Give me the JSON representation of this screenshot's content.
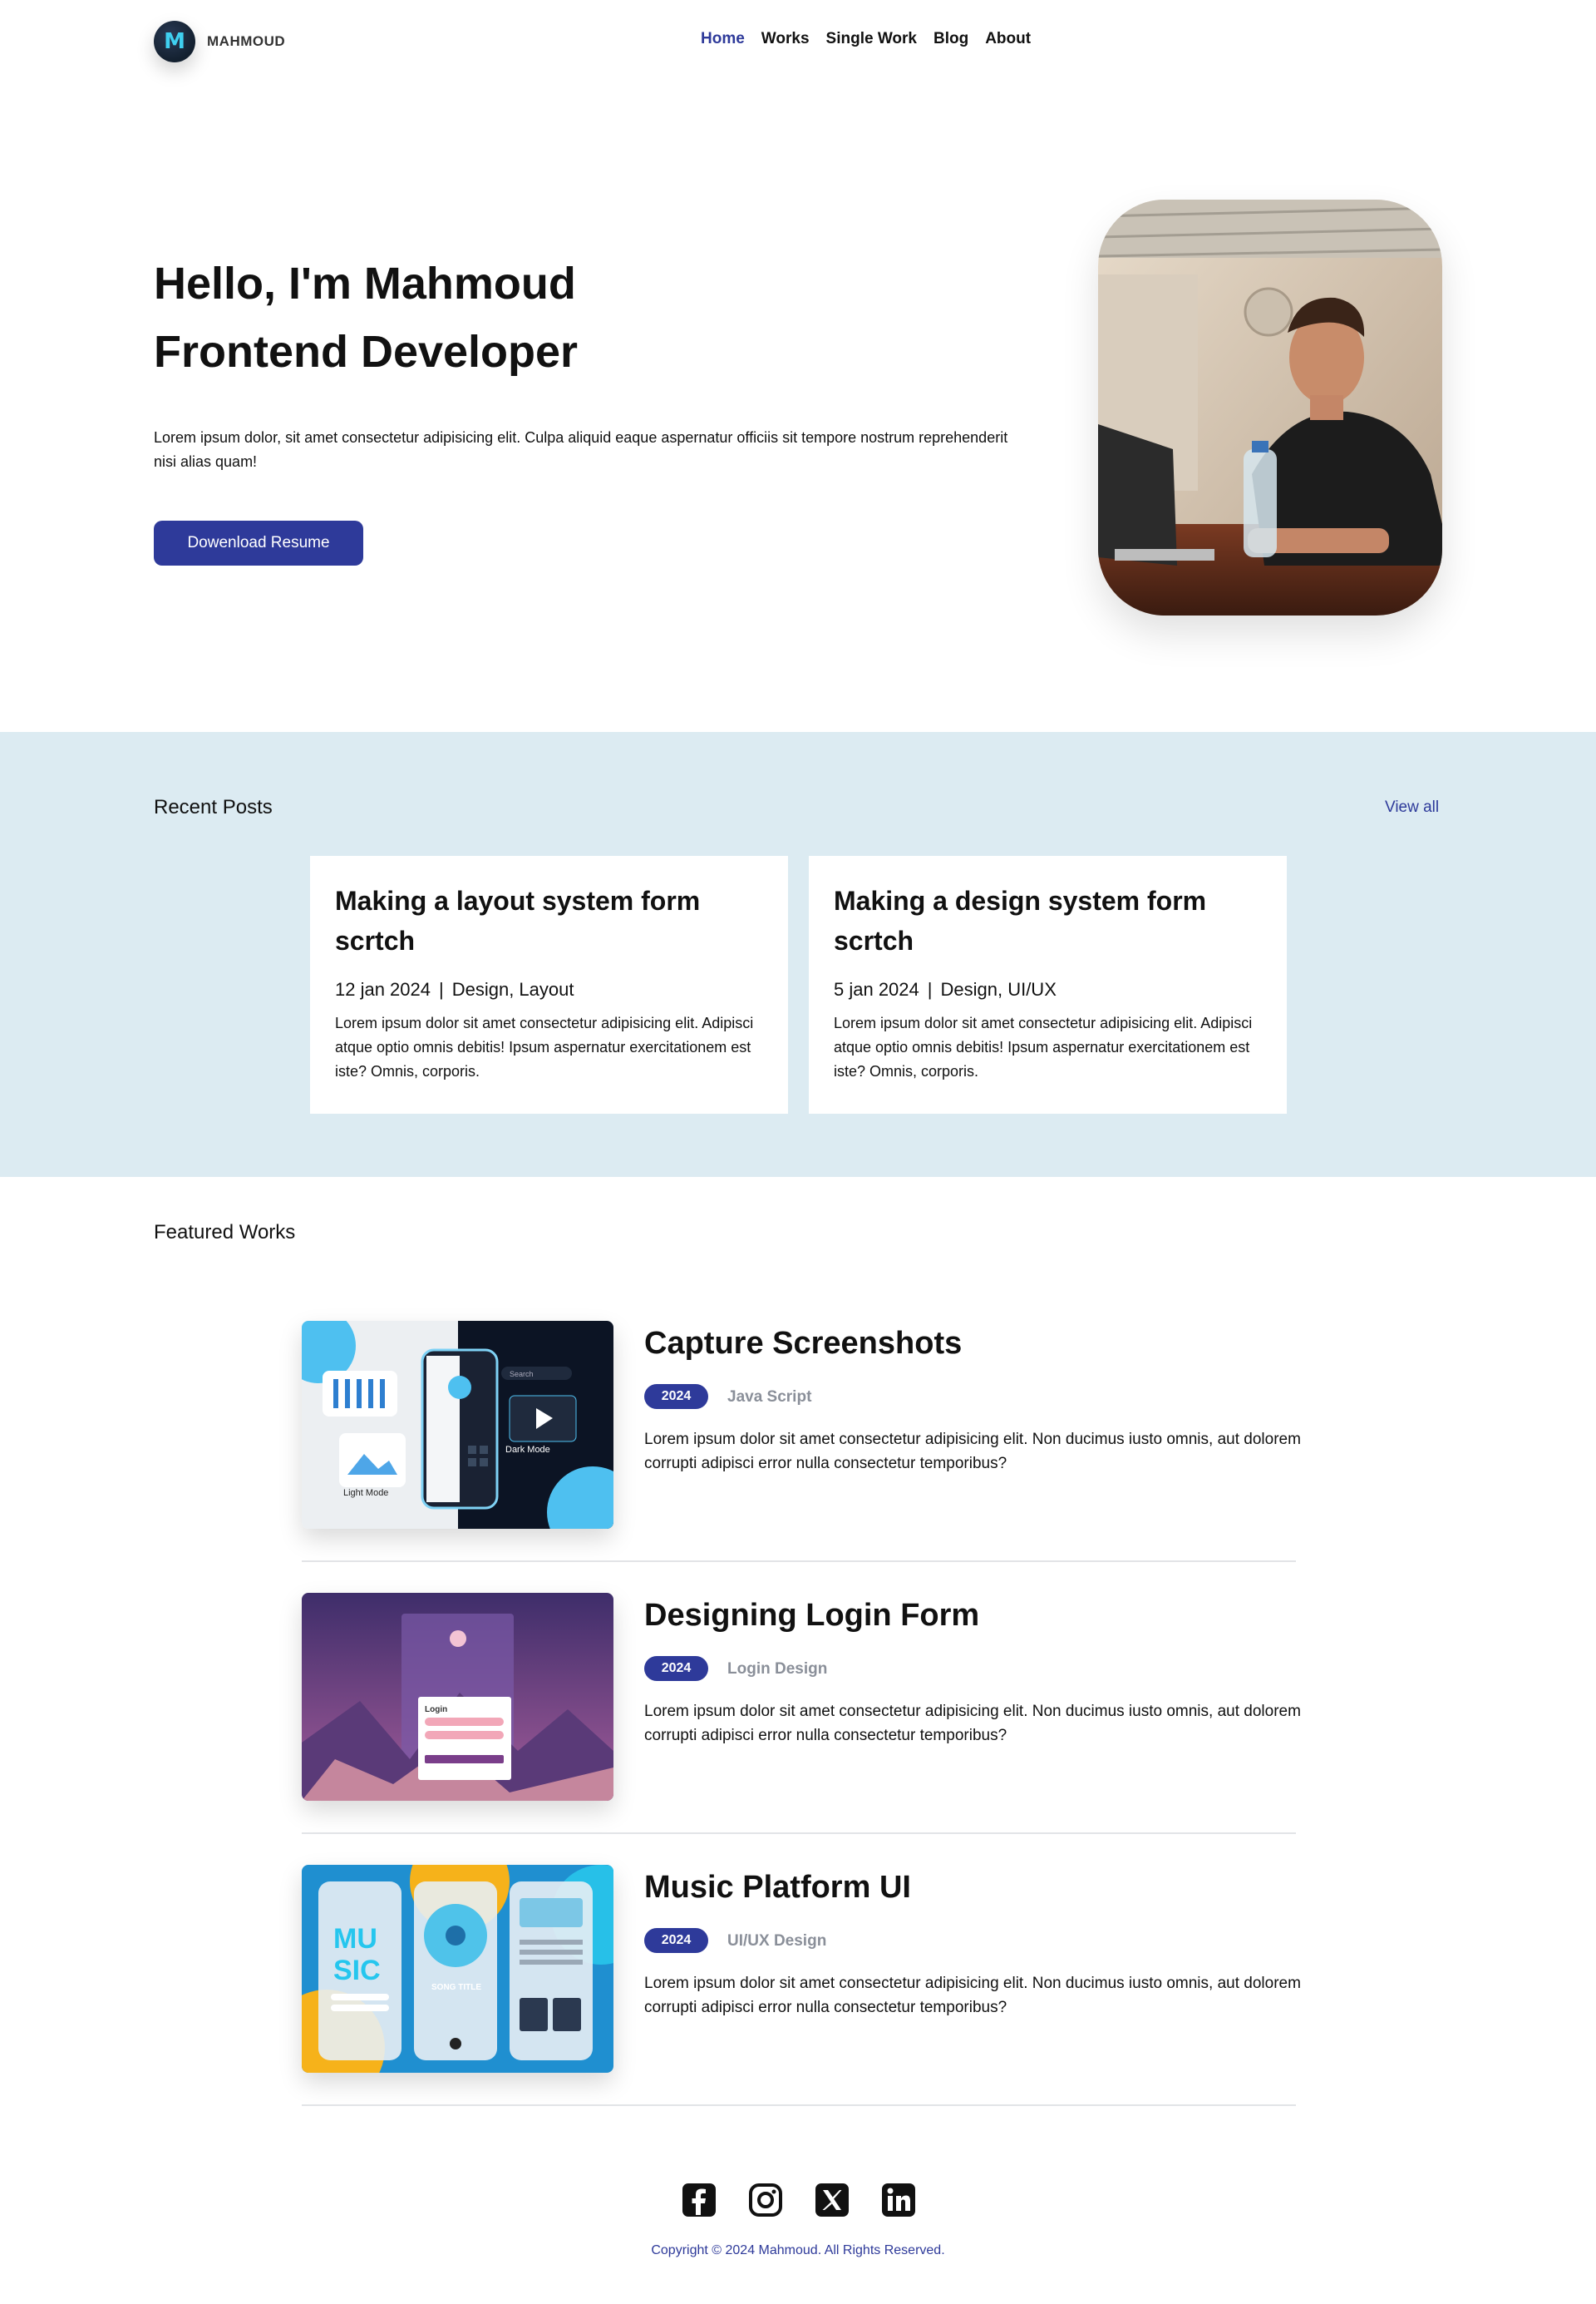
{
  "nav": {
    "logo_letter": "M",
    "brand": "MAHMOUD",
    "links": [
      {
        "label": "Home",
        "active": true
      },
      {
        "label": "Works",
        "active": false
      },
      {
        "label": "Single Work",
        "active": false
      },
      {
        "label": "Blog",
        "active": false
      },
      {
        "label": "About",
        "active": false
      }
    ]
  },
  "hero": {
    "title_line1": "Hello, I'm Mahmoud",
    "title_line2": "Frontend Developer",
    "description": "Lorem ipsum dolor, sit amet consectetur adipisicing elit. Culpa aliquid eaque aspernatur officiis sit tempore nostrum reprehenderit nisi alias quam!",
    "button_label": "Dowenload Resume"
  },
  "recent_posts": {
    "heading": "Recent Posts",
    "view_all": "View all",
    "items": [
      {
        "title": "Making a layout system form scrtch",
        "date": "12 jan 2024",
        "tags": "Design, Layout",
        "body": "Lorem ipsum dolor sit amet consectetur adipisicing elit. Adipisci atque optio omnis debitis! Ipsum aspernatur exercitationem est iste? Omnis, corporis."
      },
      {
        "title": "Making a design system form scrtch",
        "date": "5 jan 2024",
        "tags": "Design, UI/UX",
        "body": "Lorem ipsum dolor sit amet consectetur adipisicing elit. Adipisci atque optio omnis debitis! Ipsum aspernatur exercitationem est iste? Omnis, corporis."
      }
    ]
  },
  "featured": {
    "heading": "Featured Works",
    "items": [
      {
        "title": "Capture Screenshots",
        "year": "2024",
        "category": "Java Script",
        "description": "Lorem ipsum dolor sit amet consectetur adipisicing elit. Non ducimus iusto omnis, aut dolorem corrupti adipisci error nulla consectetur temporibus?",
        "thumb_label_left": "Light Mode",
        "thumb_label_right": "Dark Mode",
        "thumb_search": "Search"
      },
      {
        "title": "Designing Login Form",
        "year": "2024",
        "category": "Login Design",
        "description": "Lorem ipsum dolor sit amet consectetur adipisicing elit. Non ducimus iusto omnis, aut dolorem corrupti adipisci error nulla consectetur temporibus?",
        "thumb_heading": "Login"
      },
      {
        "title": "Music Platform UI",
        "year": "2024",
        "category": "UI/UX Design",
        "description": "Lorem ipsum dolor sit amet consectetur adipisicing elit. Non ducimus iusto omnis, aut dolorem corrupti adipisci error nulla consectetur temporibus?",
        "thumb_word_1": "MU",
        "thumb_word_2": "SIC",
        "thumb_song": "SONG TITLE"
      }
    ]
  },
  "footer": {
    "socials": [
      "facebook-icon",
      "instagram-icon",
      "x-icon",
      "linkedin-icon"
    ],
    "copyright": "Copyright © 2024 Mahmoud. All Rights Reserved."
  },
  "colors": {
    "accent": "#2e3a9a",
    "posts_background": "#dcebf2",
    "muted": "#8a8f99"
  }
}
